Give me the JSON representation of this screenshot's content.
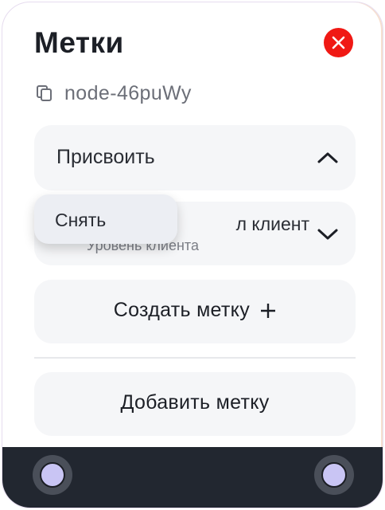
{
  "panel": {
    "title": "Метки",
    "node_id": "node-46puWy"
  },
  "assign": {
    "label": "Присвоить",
    "expanded": true
  },
  "popover": {
    "option": "Снять"
  },
  "client_tag": {
    "name_visible": "л клиент",
    "subtitle": "Уровень клиента",
    "dot_color": "#e11d20"
  },
  "actions": {
    "create_label": "Создать метку",
    "add_label": "Добавить метку"
  },
  "icons": {
    "close": "close-icon",
    "copy": "copy-icon",
    "chevron_up": "chevron-up-icon",
    "chevron_down": "chevron-down-icon",
    "plus": "plus-icon"
  },
  "colors": {
    "close_button": "#f01914",
    "footer": "#222730",
    "handle_fill": "#c9c5f4"
  }
}
